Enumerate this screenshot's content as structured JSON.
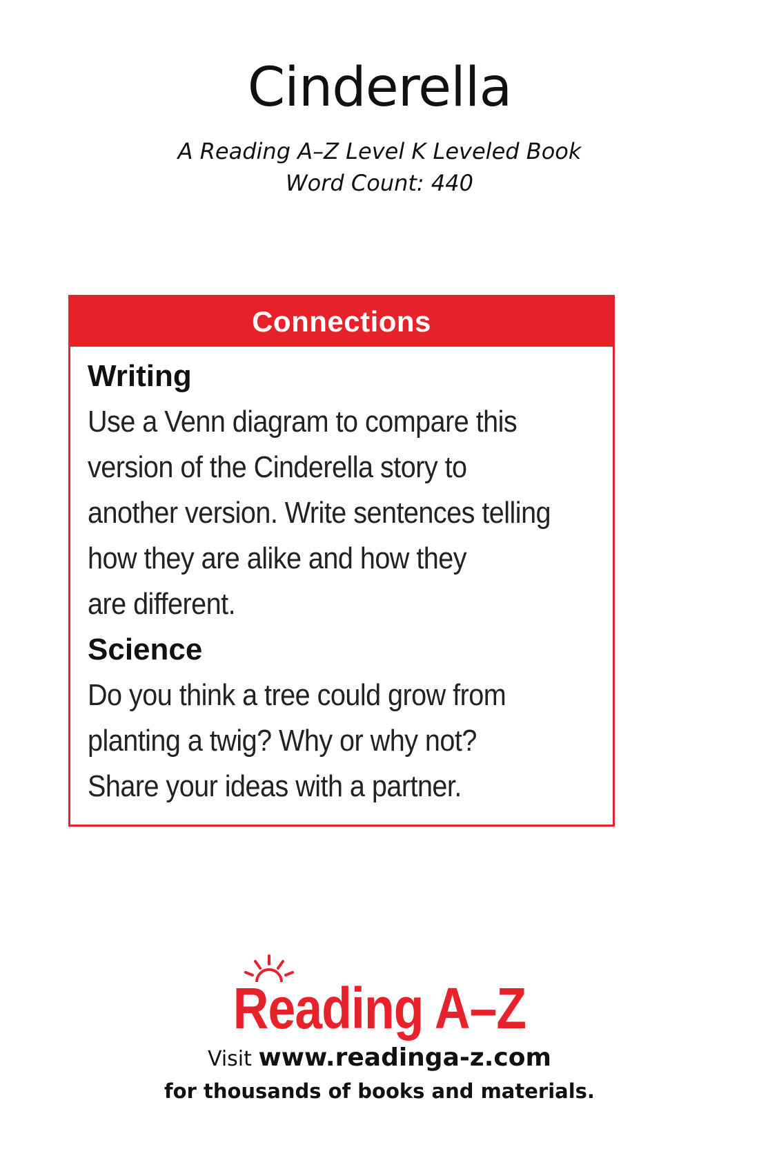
{
  "book": {
    "title": "Cinderella",
    "subtitle_line1": "A Reading A–Z Level K Leveled Book",
    "subtitle_line2": "Word Count: 440"
  },
  "connections": {
    "header": "Connections",
    "sections": [
      {
        "heading": "Writing",
        "lines": [
          "Use a Venn diagram to compare this",
          "version of the Cinderella story to",
          "another version. Write sentences telling",
          "how they are alike and how they",
          "are different."
        ]
      },
      {
        "heading": "Science",
        "lines": [
          "Do you think a tree could grow from",
          "planting a twig? Why or why not?",
          "Share your ideas with a partner."
        ]
      }
    ]
  },
  "logo": {
    "text": "Reading A–Z",
    "icon": "sun-icon",
    "color": "#e8222a"
  },
  "footer": {
    "visit_label": "Visit",
    "url": "www.readinga-z.com",
    "tagline": "for thousands of books and materials."
  }
}
